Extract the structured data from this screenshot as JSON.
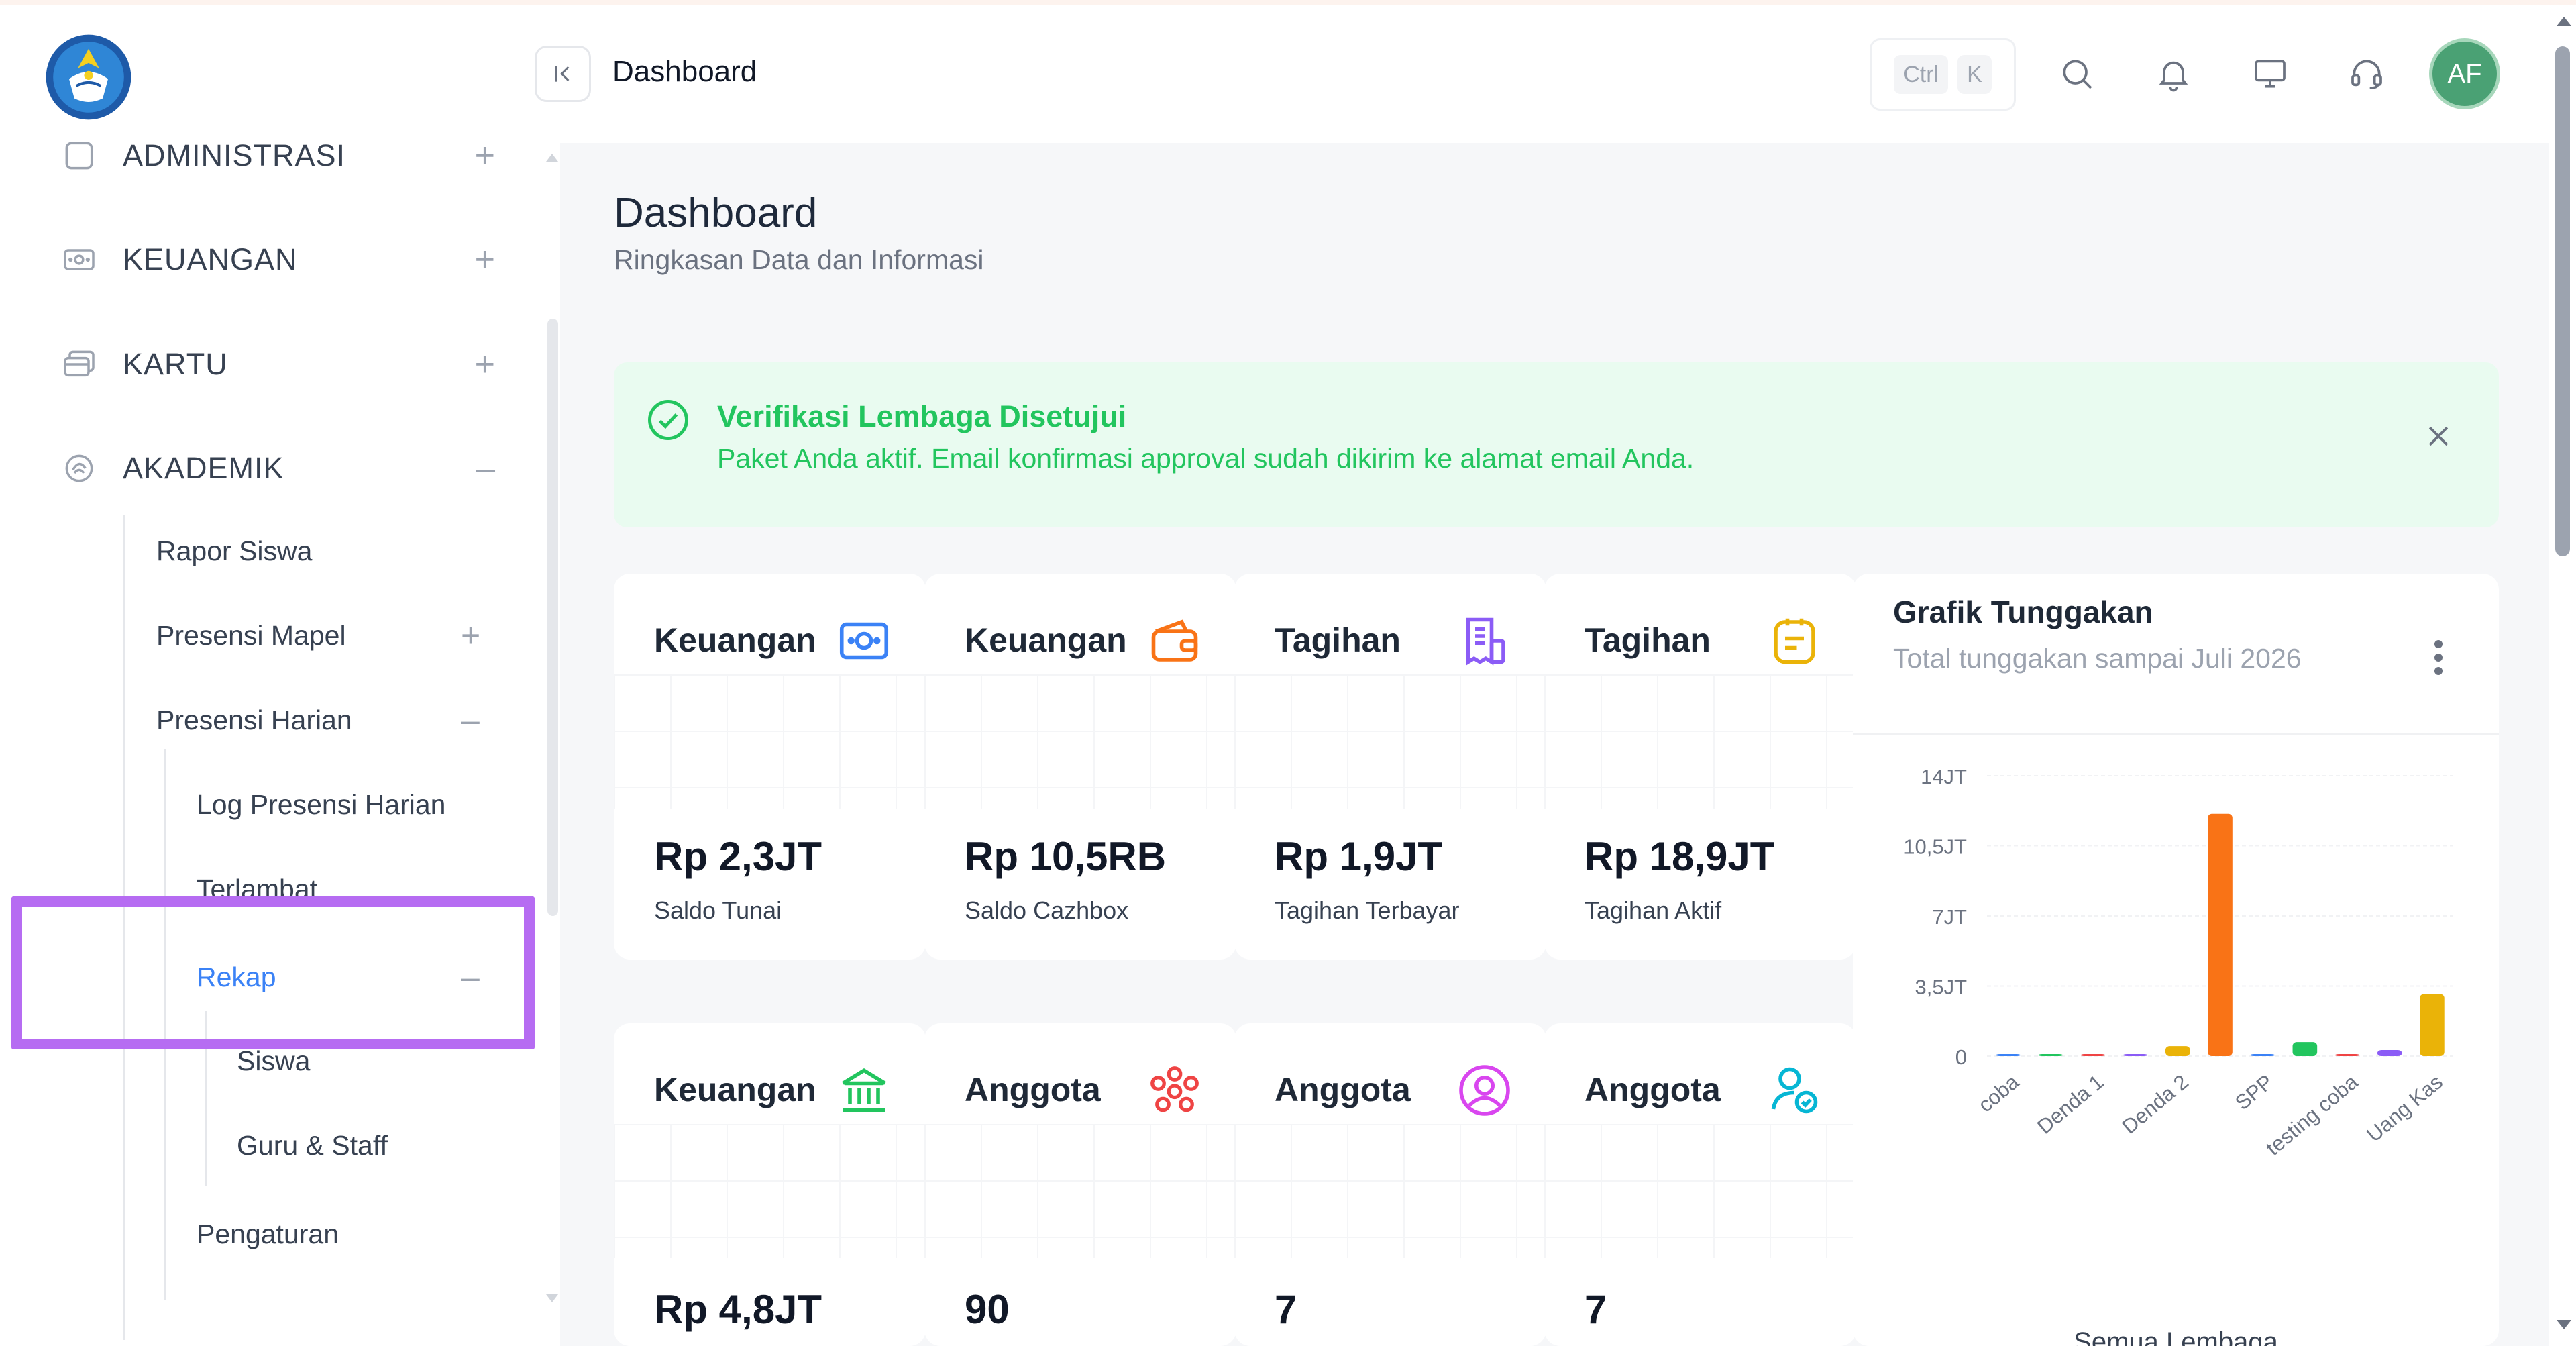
{
  "topbar": {
    "breadcrumb_title": "Dashboard",
    "kbd_ctrl": "Ctrl",
    "kbd_k": "K",
    "avatar_initials": "AF"
  },
  "sidebar": {
    "menu": [
      {
        "label": "ADMINISTRASI",
        "icon": "checkbox-icon",
        "toggle": "+"
      },
      {
        "label": "KEUANGAN",
        "icon": "cash-icon",
        "toggle": "+"
      },
      {
        "label": "KARTU",
        "icon": "card-icon",
        "toggle": "+"
      },
      {
        "label": "AKADEMIK",
        "icon": "academic-icon",
        "toggle": "–"
      }
    ],
    "akademik_sub": {
      "rapor": "Rapor Siswa",
      "presensi_mapel": "Presensi Mapel",
      "presensi_mapel_toggle": "+",
      "presensi_harian": "Presensi Harian",
      "presensi_harian_toggle": "–",
      "log_presensi": "Log Presensi Harian",
      "terlambat": "Terlambat",
      "rekap": "Rekap",
      "rekap_toggle": "–",
      "siswa": "Siswa",
      "guru_staff": "Guru & Staff",
      "pengaturan": "Pengaturan"
    }
  },
  "page": {
    "title": "Dashboard",
    "subtitle": "Ringkasan Data dan Informasi"
  },
  "alert": {
    "title": "Verifikasi Lembaga Disetujui",
    "message": "Paket Anda aktif. Email konfirmasi approval sudah dikirim ke alamat email Anda."
  },
  "cards_row1": [
    {
      "title": "Keuangan",
      "value": "Rp 2,3JT",
      "label": "Saldo Tunai",
      "icon": "cash-icon",
      "color": "#3b82f6"
    },
    {
      "title": "Keuangan",
      "value": "Rp 10,5RB",
      "label": "Saldo Cazhbox",
      "icon": "wallet-icon",
      "color": "#f97316"
    },
    {
      "title": "Tagihan",
      "value": "Rp 1,9JT",
      "label": "Tagihan Terbayar",
      "icon": "bill-icon",
      "color": "#8b5cf6"
    },
    {
      "title": "Tagihan",
      "value": "Rp 18,9JT",
      "label": "Tagihan Aktif",
      "icon": "note-icon",
      "color": "#eab308"
    }
  ],
  "cards_row2": [
    {
      "title": "Keuangan",
      "value": "Rp 4,8JT",
      "icon": "bank-icon",
      "color": "#22c55e"
    },
    {
      "title": "Anggota",
      "value": "90",
      "icon": "group-icon",
      "color": "#ef4444"
    },
    {
      "title": "Anggota",
      "value": "7",
      "icon": "user-circle-icon",
      "color": "#d946ef"
    },
    {
      "title": "Anggota",
      "value": "7",
      "icon": "user-check-icon",
      "color": "#06b6d4"
    }
  ],
  "chart": {
    "title": "Grafik Tunggakan",
    "subtitle": "Total tunggakan sampai Juli 2026",
    "footer": "Semua Lembaga"
  },
  "chart_data": {
    "type": "bar",
    "title": "Grafik Tunggakan",
    "subtitle": "Total tunggakan sampai Juli 2026",
    "categories": [
      "coba",
      "Denda 1",
      "Denda 2",
      "SPP",
      "testing coba",
      "Uang Kas"
    ],
    "bars": [
      {
        "label": "coba",
        "value": 20000,
        "color": "#3b82f6"
      },
      {
        "label": "",
        "value": 20000,
        "color": "#22c55e"
      },
      {
        "label": "Denda 1",
        "value": 100000,
        "color": "#ef4444"
      },
      {
        "label": "",
        "value": 20000,
        "color": "#8b5cf6"
      },
      {
        "label": "Denda 2",
        "value": 500000,
        "color": "#eab308"
      },
      {
        "label": "",
        "value": 12100000,
        "color": "#f97316"
      },
      {
        "label": "SPP",
        "value": 100000,
        "color": "#3b82f6"
      },
      {
        "label": "",
        "value": 700000,
        "color": "#22c55e"
      },
      {
        "label": "testing coba",
        "value": 20000,
        "color": "#ef4444"
      },
      {
        "label": "",
        "value": 300000,
        "color": "#8b5cf6"
      },
      {
        "label": "Uang Kas",
        "value": 3100000,
        "color": "#eab308"
      }
    ],
    "y_ticks": [
      "0",
      "3,5JT",
      "7JT",
      "10,5JT",
      "14JT"
    ],
    "ylim": [
      0,
      14000000
    ],
    "grid": true
  }
}
